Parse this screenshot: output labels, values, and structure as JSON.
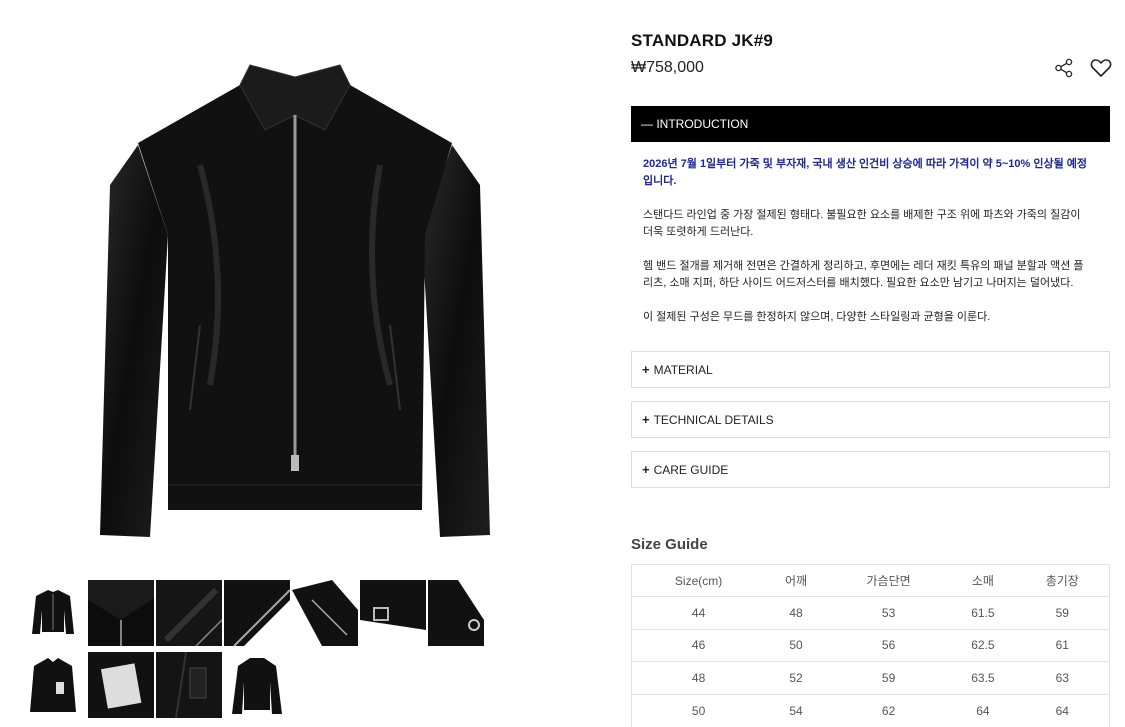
{
  "product": {
    "title": "STANDARD JK#9",
    "price": "₩758,000"
  },
  "icons": {
    "share": "share-icon",
    "wishlist": "heart-icon"
  },
  "intro": {
    "label": "— INTRODUCTION",
    "notice": "2026년 7월 1일부터 가죽 및 부자재, 국내 생산 인건비 상승에 따라 가격이 약 5~10% 인상될 예정입니다.",
    "p1": "스탠다드 라인업 중 가장 절제된 형태다. 불필요한 요소를 배제한 구조 위에 파츠와 가죽의 질감이 더욱 또렷하게 드러난다.",
    "p2": "헴 밴드 절개를 제거해 전면은 간결하게 정리하고, 후면에는 레더 재킷 특유의 패널 분할과 액션 플리츠, 소매 지퍼, 하단 사이드 어드저스터를 배치했다. 필요한 요소만 남기고 나머지는 덜어냈다.",
    "p3": "이 절제된 구성은 무드를 한정하지 않으며, 다양한 스타일링과 균형을 이룬다."
  },
  "accordion": [
    {
      "plus": "+",
      "label": "MATERIAL"
    },
    {
      "plus": "+",
      "label": "TECHNICAL DETAILS"
    },
    {
      "plus": "+",
      "label": "CARE GUIDE"
    }
  ],
  "size_guide": {
    "title": "Size Guide",
    "headers": [
      "Size(cm)",
      "어깨",
      "가슴단면",
      "소매",
      "총기장"
    ],
    "rows": [
      [
        "44",
        "48",
        "53",
        "61.5",
        "59"
      ],
      [
        "46",
        "50",
        "56",
        "62.5",
        "61"
      ],
      [
        "48",
        "52",
        "59",
        "63.5",
        "63"
      ],
      [
        "50",
        "54",
        "62",
        "64",
        "64"
      ]
    ]
  },
  "gallery": {
    "thumbnails": [
      "front-full",
      "collar-detail",
      "leather-texture",
      "zipper-detail",
      "sleeve-zipper",
      "cuff-adjuster",
      "zipper-pull",
      "front-open",
      "label-tag",
      "inner-label",
      "back-full"
    ]
  }
}
